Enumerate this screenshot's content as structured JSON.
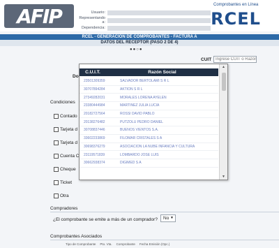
{
  "header": {
    "logo_text": "AFIP",
    "fields": [
      {
        "label": "Usuario:"
      },
      {
        "label": "Representando a:"
      },
      {
        "label": "Dependencia:"
      }
    ],
    "rcel_tagline": "Comprobantes en Línea",
    "rcel_logo": "RCEL"
  },
  "title_bar": "RCEL - GENERACIÓN DE COMPROBANTES - FACTURA A",
  "sub_bar": "DATOS DEL RECEPTOR (PASO 2 DE 4)",
  "step_dots": "●●○●",
  "cuit": {
    "label": "CUIT",
    "placeholder": "Ingrese CUIT o Razón Social"
  },
  "domicilio_label": "Do",
  "condiciones": {
    "title": "Condiciones",
    "options": [
      "Contado",
      "Tarjeta d",
      "Tarjeta d",
      "Cuenta C",
      "Cheque",
      "Ticket",
      "Otra"
    ]
  },
  "dropdown": {
    "col_cuit": "C.U.I.T.",
    "col_razon": "Razón Social",
    "rows": [
      {
        "cuit": "23501309359",
        "razon": "SALVADOR BERTOLAMI S R L"
      },
      {
        "cuit": "30707894284",
        "razon": "AKTION S R L"
      },
      {
        "cuit": "27349282031",
        "razon": "MORALES LORENA AYELEN"
      },
      {
        "cuit": "23380444984",
        "razon": "MARTINEZ JULIA LUCIA"
      },
      {
        "cuit": "20182727564",
        "razon": "ROSSI DAVID PABLO"
      },
      {
        "cuit": "20138276482",
        "razon": "PUTZOLU PEDRO DANIEL"
      },
      {
        "cuit": "30708837446",
        "razon": "BUENOS VIENTOS S.A."
      },
      {
        "cuit": "33602233869",
        "razon": "FILOMAR CRISTALES S A"
      },
      {
        "cuit": "30698376279",
        "razon": "ASOCIACION LA NUBE INFANCIA Y CULTURA"
      },
      {
        "cuit": "23119571839",
        "razon": "LOMBARDO JOSE LUIS"
      },
      {
        "cuit": "30662938374",
        "razon": "DIGIMED S A"
      }
    ]
  },
  "compradores": {
    "title": "Compradores",
    "question": "¿El comprobante se emite a más de un comprador?",
    "select_value": "No"
  },
  "asociados": {
    "title": "Comprobantes Asociados",
    "columns": [
      "Tipo de Comprobante",
      "Pto. Vta.",
      "Comprobante",
      "Fecha Emisión (Opc.)"
    ]
  }
}
